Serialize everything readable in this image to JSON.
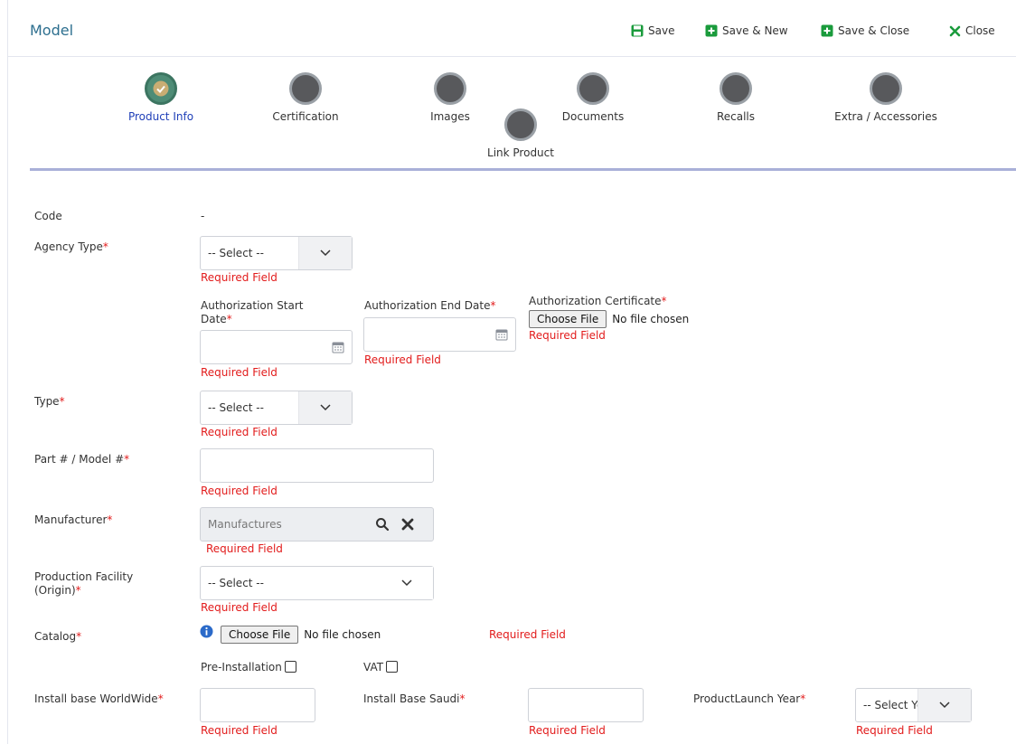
{
  "header": {
    "title": "Model",
    "save": "Save",
    "save_new": "Save & New",
    "save_close": "Save & Close",
    "close": "Close"
  },
  "steps": [
    {
      "label": "Product Info",
      "done": true
    },
    {
      "label": "Certification"
    },
    {
      "label": "Images"
    },
    {
      "label": "Documents"
    },
    {
      "label": "Recalls"
    },
    {
      "label": "Extra / Accessories"
    },
    {
      "label": "Link Product"
    }
  ],
  "form": {
    "code_label": "Code",
    "code_value": "-",
    "agency_type_label": "Agency Type",
    "select_placeholder": "-- Select --",
    "auth_start_label": "Authorization Start Date",
    "auth_end_label": "Authorization End Date",
    "auth_cert_label": "Authorization Certificate",
    "choose_file": "Choose File",
    "no_file": "No file chosen",
    "type_label": "Type",
    "part_model_label": "Part # / Model #",
    "manufacturer_label": "Manufacturer",
    "manufacturer_placeholder": "Manufactures",
    "production_facility_label": "Production Facility (Origin)",
    "catalog_label": "Catalog",
    "pre_installation_label": "Pre-Installation",
    "vat_label": "VAT",
    "install_worldwide_label": "Install base WorldWide",
    "install_saudi_label": "Install Base Saudi",
    "launch_year_label": "ProductLaunch Year",
    "select_year_placeholder": "-- Select Year--",
    "required_field": "Required Field",
    "required_mark": "*"
  },
  "colors": {
    "accent": "#2d6f8f",
    "action_green": "#1a9b3c",
    "error": "#e21b1b",
    "active_step": "#1f3fb8"
  }
}
